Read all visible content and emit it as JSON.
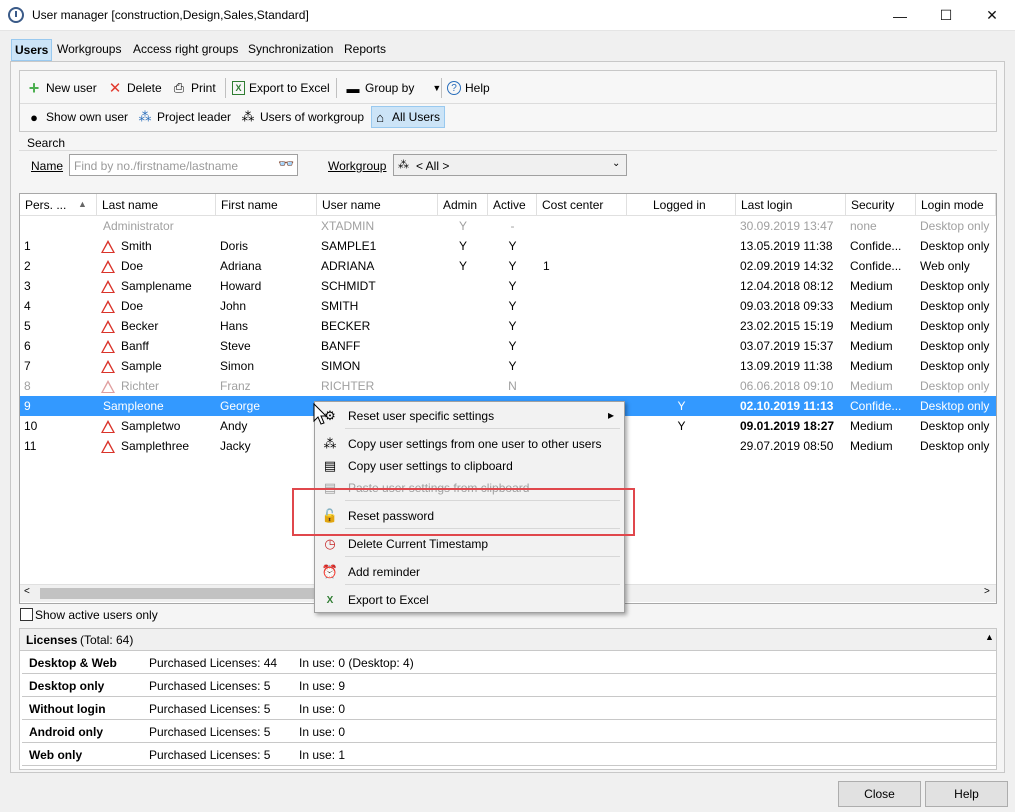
{
  "window": {
    "title": "User manager [construction,Design,Sales,Standard]",
    "minimize": "—",
    "maximize": "☐",
    "close": "✕"
  },
  "tabs": [
    "Users",
    "Workgroups",
    "Access right groups",
    "Synchronization",
    "Reports"
  ],
  "toolbar": {
    "new_user": "New user",
    "delete": "Delete",
    "print": "Print",
    "export": "Export to Excel",
    "group_by": "Group by",
    "help": "Help",
    "show_own": "Show own user",
    "project_leader": "Project leader",
    "users_of_workgroup": "Users of workgroup",
    "all_users": "All Users"
  },
  "search": {
    "label": "Search",
    "name_label": "Name",
    "name_placeholder": "Find by no./firstname/lastname",
    "workgroup_label": "Workgroup",
    "workgroup_value": "< All >"
  },
  "grid": {
    "columns": [
      "Pers. ...",
      "Last name",
      "First name",
      "User name",
      "Admin",
      "Active",
      "Cost center",
      "Logged in",
      "Last login",
      "Security",
      "Login mode"
    ],
    "rows": [
      {
        "pers": "",
        "last": "Administrator",
        "first": "",
        "user": "XTADMIN",
        "admin": "Y",
        "active": "-",
        "cost": "",
        "logged": "",
        "lastlogin": "30.09.2019 13:47",
        "security": "none",
        "mode": "Desktop only",
        "warn": false,
        "state": "disabled"
      },
      {
        "pers": "1",
        "last": "Smith",
        "first": "Doris",
        "user": "SAMPLE1",
        "admin": "Y",
        "active": "Y",
        "cost": "",
        "logged": "",
        "lastlogin": "13.05.2019 11:38",
        "security": "Confide...",
        "mode": "Desktop only",
        "warn": true,
        "state": ""
      },
      {
        "pers": "2",
        "last": "Doe",
        "first": "Adriana",
        "user": "ADRIANA",
        "admin": "Y",
        "active": "Y",
        "cost": "1",
        "logged": "",
        "lastlogin": "02.09.2019 14:32",
        "security": "Confide...",
        "mode": "Web only",
        "warn": true,
        "state": ""
      },
      {
        "pers": "3",
        "last": "Samplename",
        "first": "Howard",
        "user": "SCHMIDT",
        "admin": "",
        "active": "Y",
        "cost": "",
        "logged": "",
        "lastlogin": "12.04.2018 08:12",
        "security": "Medium",
        "mode": "Desktop only",
        "warn": true,
        "state": ""
      },
      {
        "pers": "4",
        "last": "Doe",
        "first": "John",
        "user": "SMITH",
        "admin": "",
        "active": "Y",
        "cost": "",
        "logged": "",
        "lastlogin": "09.03.2018 09:33",
        "security": "Medium",
        "mode": "Desktop only",
        "warn": true,
        "state": ""
      },
      {
        "pers": "5",
        "last": "Becker",
        "first": "Hans",
        "user": "BECKER",
        "admin": "",
        "active": "Y",
        "cost": "",
        "logged": "",
        "lastlogin": "23.02.2015 15:19",
        "security": "Medium",
        "mode": "Desktop only",
        "warn": true,
        "state": ""
      },
      {
        "pers": "6",
        "last": "Banff",
        "first": "Steve",
        "user": "BANFF",
        "admin": "",
        "active": "Y",
        "cost": "",
        "logged": "",
        "lastlogin": "03.07.2019 15:37",
        "security": "Medium",
        "mode": "Desktop only",
        "warn": true,
        "state": ""
      },
      {
        "pers": "7",
        "last": "Sample",
        "first": "Simon",
        "user": "SIMON",
        "admin": "",
        "active": "Y",
        "cost": "",
        "logged": "",
        "lastlogin": "13.09.2019 11:38",
        "security": "Medium",
        "mode": "Desktop only",
        "warn": true,
        "state": ""
      },
      {
        "pers": "8",
        "last": "Richter",
        "first": "Franz",
        "user": "RICHTER",
        "admin": "",
        "active": "N",
        "cost": "",
        "logged": "",
        "lastlogin": "06.06.2018 09:10",
        "security": "Medium",
        "mode": "Desktop only",
        "warn": true,
        "state": "disabled"
      },
      {
        "pers": "9",
        "last": "Sampleone",
        "first": "George",
        "user": "",
        "admin": "",
        "active": "",
        "cost": "",
        "logged": "Y",
        "lastlogin": "02.10.2019 11:13",
        "security": "Confide...",
        "mode": "Desktop only",
        "warn": false,
        "state": "selected"
      },
      {
        "pers": "10",
        "last": "Sampletwo",
        "first": "Andy",
        "user": "",
        "admin": "",
        "active": "",
        "cost": "",
        "logged": "Y",
        "lastlogin": "09.01.2019 18:27",
        "security": "Medium",
        "mode": "Desktop only",
        "warn": true,
        "state": "bold"
      },
      {
        "pers": "11",
        "last": "Samplethree",
        "first": "Jacky",
        "user": "",
        "admin": "",
        "active": "",
        "cost": "",
        "logged": "",
        "lastlogin": "29.07.2019 08:50",
        "security": "Medium",
        "mode": "Desktop only",
        "warn": true,
        "state": ""
      }
    ]
  },
  "show_active_only": "Show active users only",
  "licenses": {
    "title": "Licenses",
    "total": "(Total: 64)",
    "rows": [
      {
        "name": "Desktop & Web",
        "purchased": "Purchased Licenses: 44",
        "inuse": "In use: 0 (Desktop: 4)"
      },
      {
        "name": "Desktop only",
        "purchased": "Purchased Licenses: 5",
        "inuse": "In use: 9"
      },
      {
        "name": "Without login",
        "purchased": "Purchased Licenses: 5",
        "inuse": "In use: 0"
      },
      {
        "name": "Android only",
        "purchased": "Purchased Licenses: 5",
        "inuse": "In use: 0"
      },
      {
        "name": "Web only",
        "purchased": "Purchased Licenses: 5",
        "inuse": "In use: 1"
      }
    ]
  },
  "context_menu": {
    "items": [
      {
        "label": "Reset user specific settings",
        "icon": "settings-reset-icon",
        "submenu": true
      },
      {
        "label": "Copy user settings from one user to other users",
        "icon": "users-icon"
      },
      {
        "label": "Copy user settings to clipboard",
        "icon": "clipboard-icon"
      },
      {
        "label": "Paste user settings from clipboard",
        "icon": "paste-icon",
        "disabled": true
      },
      {
        "label": "Reset password",
        "icon": "lock-icon"
      },
      {
        "label": "Delete Current Timestamp",
        "icon": "clock-delete-icon"
      },
      {
        "label": "Add reminder",
        "icon": "alarm-icon"
      },
      {
        "label": "Export to Excel",
        "icon": "excel-icon"
      }
    ]
  },
  "buttons": {
    "close": "Close",
    "help": "Help"
  },
  "colors": {
    "selection": "#3399ff",
    "highlight": "#e0474c",
    "tab_active": "#cce4f7"
  }
}
